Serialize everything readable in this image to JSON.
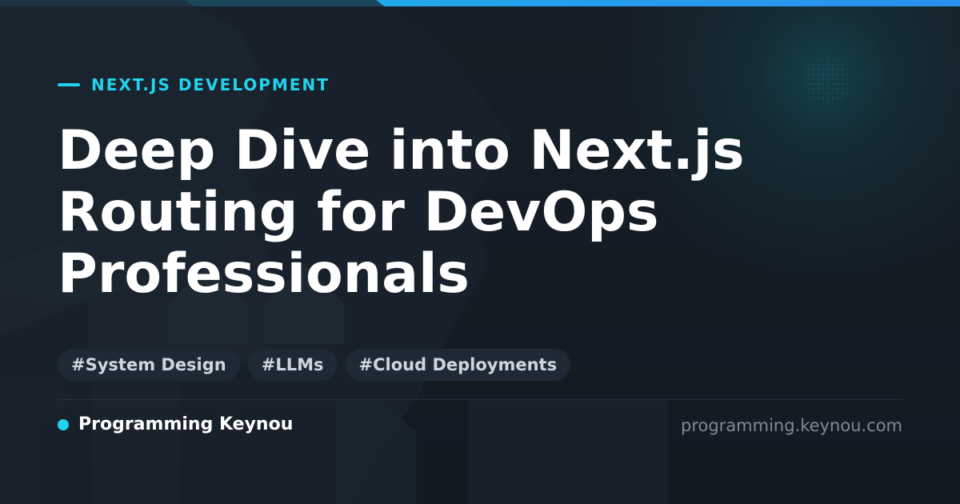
{
  "colors": {
    "accent": "#22d3ee",
    "top_bar": "#1bb7e6",
    "background": "#131a22",
    "headline": "#ffffff",
    "tag_background": "#1f2935",
    "tag_text": "#cfd6df",
    "url_text": "#7f8a97"
  },
  "category": "NEXT.JS DEVELOPMENT",
  "headline": {
    "lines": [
      "Deep Dive into Next.js",
      "Routing for DevOps",
      "Professionals"
    ]
  },
  "tags": [
    "#System Design",
    "#LLMs",
    "#Cloud Deployments"
  ],
  "footer": {
    "brand": "Programming Keynou",
    "url": "programming.keynou.com"
  }
}
